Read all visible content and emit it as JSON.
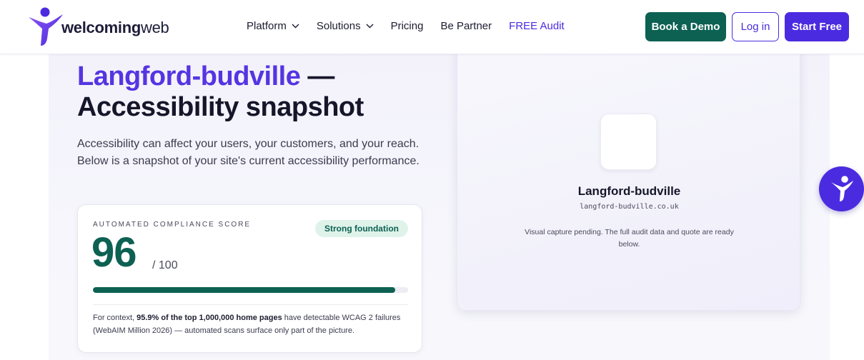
{
  "header": {
    "logo": {
      "bold": "welcoming",
      "light": "web",
      "icon": "welcomingweb-figure-icon"
    },
    "nav": [
      {
        "label": "Platform",
        "dropdown": true
      },
      {
        "label": "Solutions",
        "dropdown": true
      },
      {
        "label": "Pricing",
        "dropdown": false
      },
      {
        "label": "Be Partner",
        "dropdown": false
      },
      {
        "label": "FREE Audit",
        "dropdown": false,
        "accent": true
      }
    ],
    "buttons": {
      "demo": "Book a Demo",
      "login": "Log in",
      "start": "Start Free"
    }
  },
  "hero": {
    "site_name": "Langford-budville",
    "dash": " —",
    "subtitle": "Accessibility snapshot",
    "intro": "Accessibility can affect your users, your customers, and your reach. Below is a snapshot of your site's current accessibility performance."
  },
  "score": {
    "label": "AUTOMATED COMPLIANCE SCORE",
    "badge": "Strong foundation",
    "value": "96",
    "max": "/ 100",
    "progress_fraction": 0.96,
    "note": {
      "prefix": "For context, ",
      "highlight": "95.9% of the top 1,000,000 home pages",
      "suffix": " have detectable WCAG 2 failures (WebAIM Million 2026) — automated scans surface only part of the picture."
    }
  },
  "preview": {
    "name": "Langford-budville",
    "domain": "langford-budville.co.uk",
    "message": "Visual capture pending. The full audit data and quote are ready below."
  },
  "colors": {
    "brand_purple": "#4b2be0",
    "brand_green": "#0c6152",
    "title_accent": "#5535e2"
  },
  "a11y_widget": {
    "icon": "accessibility-figure-icon"
  }
}
